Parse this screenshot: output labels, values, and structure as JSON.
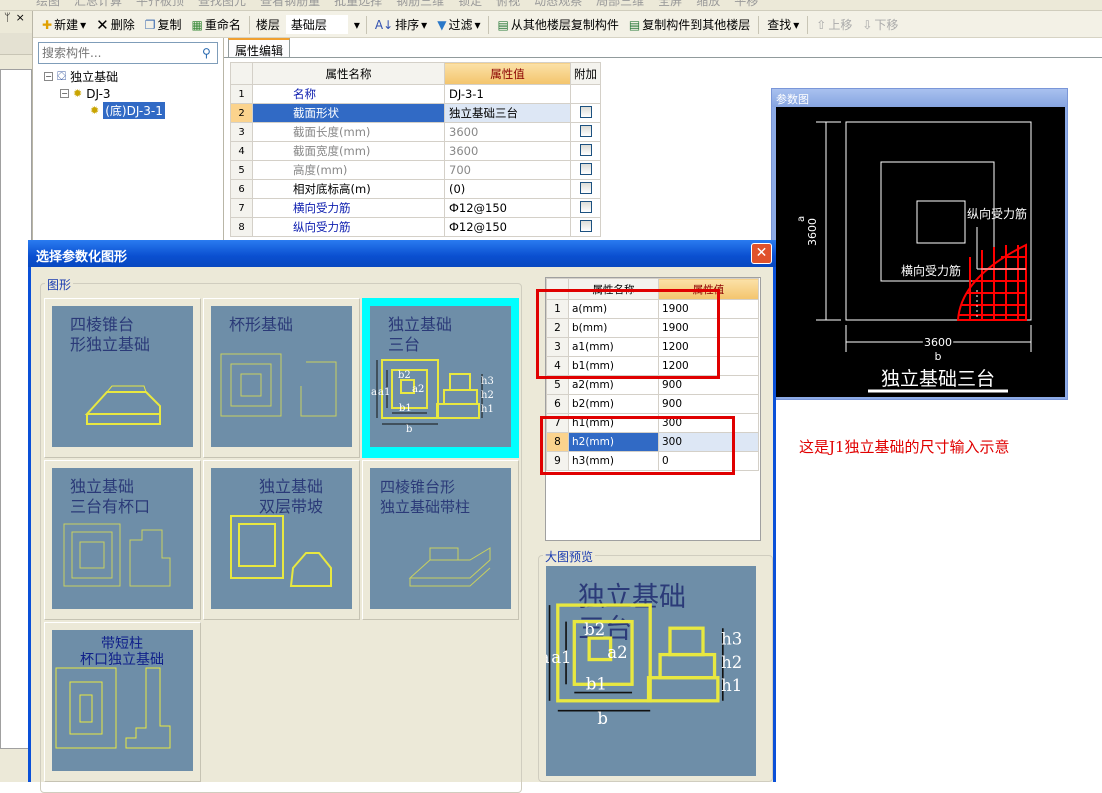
{
  "toolbar_top": [
    "绘图",
    "汇总计算",
    "平齐板顶",
    "查找图元",
    "查看钢筋量",
    "批量选择",
    "钢筋三维",
    "锁定",
    "俯视",
    "动态观察",
    "局部三维",
    "全屏",
    "缩放",
    "平移"
  ],
  "toolbar": {
    "new": "新建",
    "delete": "删除",
    "copy": "复制",
    "rename": "重命名",
    "floor_label": "楼层",
    "floor_value": "基础层",
    "sort": "排序",
    "filter": "过滤",
    "copy_from": "从其他楼层复制构件",
    "copy_to": "复制构件到其他楼层",
    "find": "查找",
    "move_up": "上移",
    "move_down": "下移"
  },
  "left_pane": {
    "pin": "ᛘ",
    "close": "×"
  },
  "search": {
    "placeholder": "搜索构件..."
  },
  "tree": {
    "root": "独立基础",
    "child": "DJ-3",
    "leaf": "(底)DJ-3-1"
  },
  "prop_tab": "属性编辑",
  "prop_grid": {
    "headers": [
      "属性名称",
      "属性值",
      "附加"
    ],
    "rows": [
      {
        "n": "1",
        "name": "名称",
        "value": "DJ-3-1"
      },
      {
        "n": "2",
        "name": "截面形状",
        "value": "独立基础三台"
      },
      {
        "n": "3",
        "name": "截面长度(mm)",
        "value": "3600"
      },
      {
        "n": "4",
        "name": "截面宽度(mm)",
        "value": "3600"
      },
      {
        "n": "5",
        "name": "高度(mm)",
        "value": "700"
      },
      {
        "n": "6",
        "name": "相对底标高(m)",
        "value": "(0)"
      },
      {
        "n": "7",
        "name": "横向受力筋",
        "value": "Ф12@150"
      },
      {
        "n": "8",
        "name": "纵向受力筋",
        "value": "Ф12@150"
      }
    ]
  },
  "param_win": {
    "title": "参数图",
    "dim_a": "3600",
    "label_a": "a",
    "dim_b": "3600",
    "label_b": "b",
    "rebar_long": "纵向受力筋",
    "rebar_trans": "横向受力筋",
    "caption": "独立基础三台"
  },
  "note": "这是J1独立基础的尺寸输入示意",
  "dialog": {
    "title": "选择参数化图形",
    "close": "✕",
    "group_shapes": "图形",
    "group_preview": "大图预览",
    "tiles": [
      {
        "t1": "四棱锥台",
        "t2": "形独立基础"
      },
      {
        "t1": "杯形基础",
        "t2": ""
      },
      {
        "t1": "独立基础",
        "t2": "三台"
      },
      {
        "t1": "独立基础",
        "t2": "三台有杯口"
      },
      {
        "t1": "独立基础",
        "t2": "双层带坡"
      },
      {
        "t1": "四棱锥台形",
        "t2": "独立基础带柱"
      },
      {
        "t1": "带短柱",
        "t2": "杯口独立基础"
      }
    ],
    "selected_tile": 2,
    "param_table": {
      "headers": [
        "属性名称",
        "属性值"
      ],
      "rows": [
        {
          "n": "1",
          "name": "a(mm)",
          "value": "1900"
        },
        {
          "n": "2",
          "name": "b(mm)",
          "value": "1900"
        },
        {
          "n": "3",
          "name": "a1(mm)",
          "value": "1200"
        },
        {
          "n": "4",
          "name": "b1(mm)",
          "value": "1200"
        },
        {
          "n": "5",
          "name": "a2(mm)",
          "value": "900"
        },
        {
          "n": "6",
          "name": "b2(mm)",
          "value": "900"
        },
        {
          "n": "7",
          "name": "h1(mm)",
          "value": "300"
        },
        {
          "n": "8",
          "name": "h2(mm)",
          "value": "300"
        },
        {
          "n": "9",
          "name": "h3(mm)",
          "value": "0"
        }
      ],
      "selected_row": 8
    },
    "dims": {
      "a": "a",
      "a1": "a1",
      "a2": "a2",
      "b": "b",
      "b1": "b1",
      "b2": "b2",
      "h1": "h1",
      "h2": "h2",
      "h3": "h3"
    }
  },
  "colors": {
    "tile_bg": "#6e8ea8",
    "highlight": "#00ffff",
    "selection": "#316ac5",
    "annotation": "#e00000",
    "diagram_line": "#ffff00"
  }
}
